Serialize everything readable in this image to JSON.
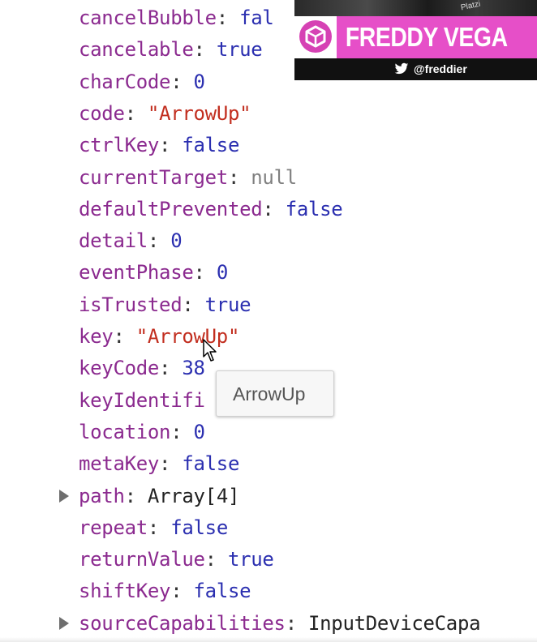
{
  "properties": [
    {
      "key": "cancelBubble",
      "value": "fal",
      "type": "bool"
    },
    {
      "key": "cancelable",
      "value": "true",
      "type": "bool"
    },
    {
      "key": "charCode",
      "value": "0",
      "type": "num"
    },
    {
      "key": "code",
      "value": "\"ArrowUp\"",
      "type": "str"
    },
    {
      "key": "ctrlKey",
      "value": "false",
      "type": "bool"
    },
    {
      "key": "currentTarget",
      "value": "null",
      "type": "null"
    },
    {
      "key": "defaultPrevented",
      "value": "false",
      "type": "bool"
    },
    {
      "key": "detail",
      "value": "0",
      "type": "num"
    },
    {
      "key": "eventPhase",
      "value": "0",
      "type": "num"
    },
    {
      "key": "isTrusted",
      "value": "true",
      "type": "bool"
    },
    {
      "key": "key",
      "value": "\"ArrowUp\"",
      "type": "str"
    },
    {
      "key": "keyCode",
      "value": "38",
      "type": "num"
    },
    {
      "key": "keyIdentifi",
      "value": "",
      "type": "str"
    },
    {
      "key": "location",
      "value": "0",
      "type": "num"
    },
    {
      "key": "metaKey",
      "value": "false",
      "type": "bool"
    },
    {
      "key": "path",
      "value": "Array[4]",
      "type": "obj",
      "expandable": true
    },
    {
      "key": "repeat",
      "value": "false",
      "type": "bool"
    },
    {
      "key": "returnValue",
      "value": "true",
      "type": "bool"
    },
    {
      "key": "shiftKey",
      "value": "false",
      "type": "bool"
    },
    {
      "key": "sourceCapabilities",
      "value": "InputDeviceCapa",
      "type": "obj",
      "expandable": true
    }
  ],
  "tooltip": {
    "text": "ArrowUp"
  },
  "overlay": {
    "brand": "Platzi",
    "name": "FREDDY VEGA",
    "handle": "@freddier",
    "logo_icon": "platzi-logo-icon",
    "social_icon": "twitter-icon",
    "colors": {
      "accent": "#e64fc8",
      "logo": "#d642b4",
      "handle_bar": "#111111"
    }
  },
  "colors": {
    "key": "#8b2a8f",
    "bool_num": "#2b2fb0",
    "string": "#c22e1f",
    "null": "#808080"
  }
}
